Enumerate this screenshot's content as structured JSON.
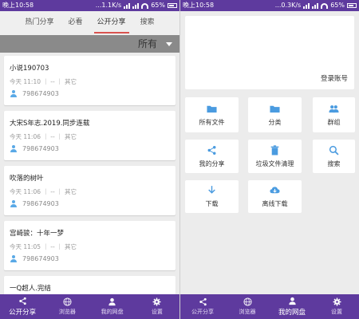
{
  "left_screen": {
    "status": {
      "time": "晚上10:58",
      "speed": "...1.1K/s",
      "battery": "65%"
    },
    "tabs": [
      "热门分享",
      "必看",
      "公开分享",
      "搜索"
    ],
    "active_tab": "公开分享",
    "filter": {
      "label": "所有"
    },
    "shares": [
      {
        "title": "小说190703",
        "meta": "今天 11:10 ｜ -- ｜ 其它",
        "user": "798674903"
      },
      {
        "title": "大宋S年志.2019.同步连载",
        "meta": "今天 11:06 ｜ -- ｜ 其它",
        "user": "798674903"
      },
      {
        "title": "吹落的树叶",
        "meta": "今天 11:06 ｜ -- ｜ 其它",
        "user": "798674903"
      },
      {
        "title": "宫崎骏：十年一梦",
        "meta": "今天 11:05 ｜ -- ｜ 其它",
        "user": "798674903"
      },
      {
        "title": "一Q超人.完结",
        "meta": "",
        "user": ""
      }
    ],
    "bottom_nav": [
      {
        "label": "公开分享",
        "icon": "share-icon"
      },
      {
        "label": "浏览器",
        "icon": "globe-icon"
      },
      {
        "label": "我的网盘",
        "icon": "person-icon"
      },
      {
        "label": "设置",
        "icon": "gear-icon"
      }
    ]
  },
  "right_screen": {
    "status": {
      "time": "晚上10:58",
      "speed": "...0.3K/s",
      "battery": "65%"
    },
    "login_label": "登录账号",
    "tiles": [
      {
        "label": "所有文件",
        "icon": "folder-icon"
      },
      {
        "label": "分类",
        "icon": "folder-icon"
      },
      {
        "label": "群组",
        "icon": "group-icon"
      },
      {
        "label": "我的分享",
        "icon": "share-icon"
      },
      {
        "label": "垃圾文件清理",
        "icon": "trash-icon"
      },
      {
        "label": "搜索",
        "icon": "search-icon"
      },
      {
        "label": "下载",
        "icon": "download-icon"
      },
      {
        "label": "离线下载",
        "icon": "cloud-download-icon"
      }
    ],
    "bottom_nav": [
      {
        "label": "公开分享",
        "icon": "share-icon"
      },
      {
        "label": "浏览器",
        "icon": "globe-icon"
      },
      {
        "label": "我的网盘",
        "icon": "person-icon"
      },
      {
        "label": "设置",
        "icon": "gear-icon"
      }
    ]
  },
  "colors": {
    "accent_purple": "#5e3a9e",
    "tab_underline": "#d9534f",
    "icon_blue": "#4a9be0"
  }
}
